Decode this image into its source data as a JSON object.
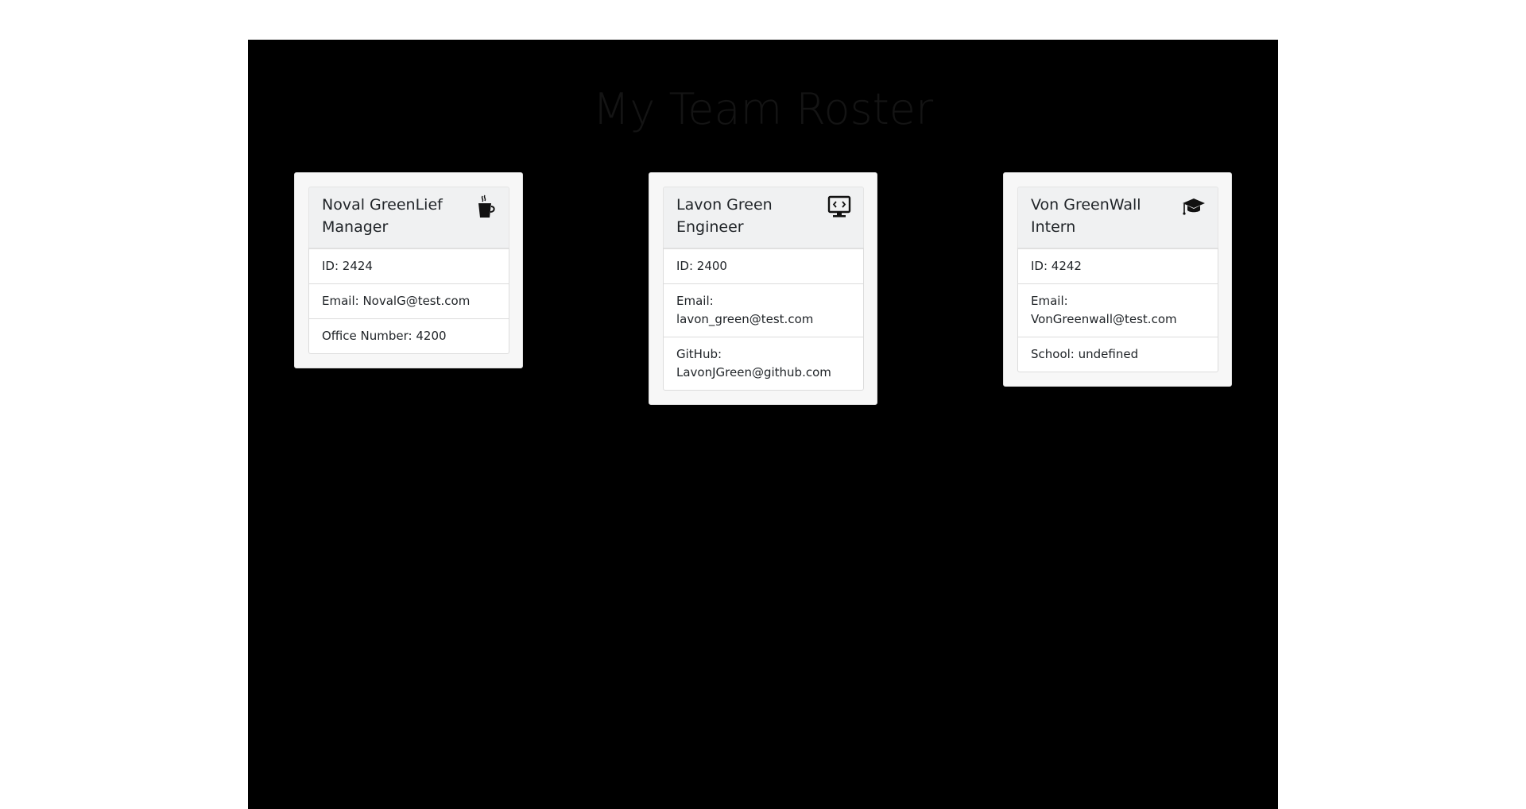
{
  "page": {
    "title": "My Team Roster"
  },
  "cards": [
    {
      "name": "Noval GreenLief",
      "role": "Manager",
      "icon": "coffee-cup-icon",
      "details": [
        "ID: 2424",
        "Email: NovalG@test.com",
        "Office Number: 4200"
      ]
    },
    {
      "name": "Lavon Green",
      "role": "Engineer",
      "icon": "monitor-code-icon",
      "details": [
        "ID: 2400",
        "Email: lavon_green@test.com",
        "GitHub: LavonJGreen@github.com"
      ]
    },
    {
      "name": "Von GreenWall",
      "role": "Intern",
      "icon": "graduation-cap-icon",
      "details": [
        "ID: 4242",
        "Email: VonGreenwall@test.com",
        "School: undefined"
      ]
    }
  ],
  "colors": {
    "page_background": "#ffffff",
    "panel_background": "#000000",
    "card_background": "#f7f7f7",
    "card_header_background": "#f0f1f2",
    "title_text": "#141414",
    "body_text": "#212529"
  }
}
